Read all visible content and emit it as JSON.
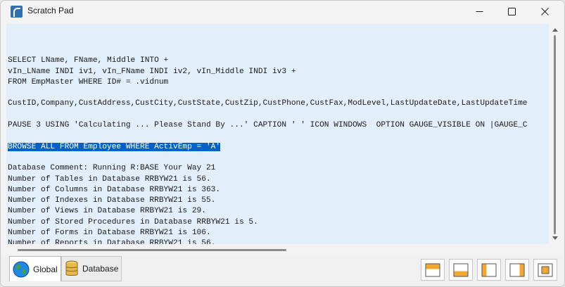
{
  "window": {
    "title": "Scratch Pad"
  },
  "editor": {
    "lines": [
      "",
      "SELECT LName, FName, Middle INTO +",
      "vIn_LName INDI iv1, vIn_FName INDI iv2, vIn_Middle INDI iv3 +",
      "FROM EmpMaster WHERE ID# = .vidnum",
      "",
      "CustID,Company,CustAddress,CustCity,CustState,CustZip,CustPhone,CustFax,ModLevel,LastUpdateDate,LastUpdateTime",
      "",
      "PAUSE 3 USING 'Calculating ... Please Stand By ...' CAPTION ' ' ICON WINDOWS  OPTION GAUGE_VISIBLE ON |GAUGE_C",
      "",
      "BROWSE ALL FROM Employee WHERE ActivEmp = 'A'",
      "",
      "Database Comment: Running R:BASE Your Way 21",
      "Number of Tables in Database RRBYW21 is 56.",
      "Number of Columns in Database RRBYW21 is 363.",
      "Number of Indexes in Database RRBYW21 is 55.",
      "Number of Views in Database RRBYW21 is 29.",
      "Number of Stored Procedures in Database RRBYW21 is 5.",
      "Number of Forms in Database RRBYW21 is 106.",
      "Number of Reports in Database RRBYW21 is 56."
    ],
    "selected_line_index": 9,
    "selection_color": "#0063cc",
    "background_color": "#e3eefb"
  },
  "tabs": [
    {
      "label": "Global",
      "icon": "globe-icon",
      "active": true
    },
    {
      "label": "Database",
      "icon": "database-icon",
      "active": false
    }
  ],
  "dock_buttons": [
    {
      "icon": "dock-top-icon"
    },
    {
      "icon": "dock-bottom-icon"
    },
    {
      "icon": "dock-left-icon"
    },
    {
      "icon": "dock-right-icon"
    },
    {
      "icon": "dock-float-icon"
    }
  ],
  "colors": {
    "accent": "#0063cc",
    "dock_accent": "#f0a830"
  }
}
